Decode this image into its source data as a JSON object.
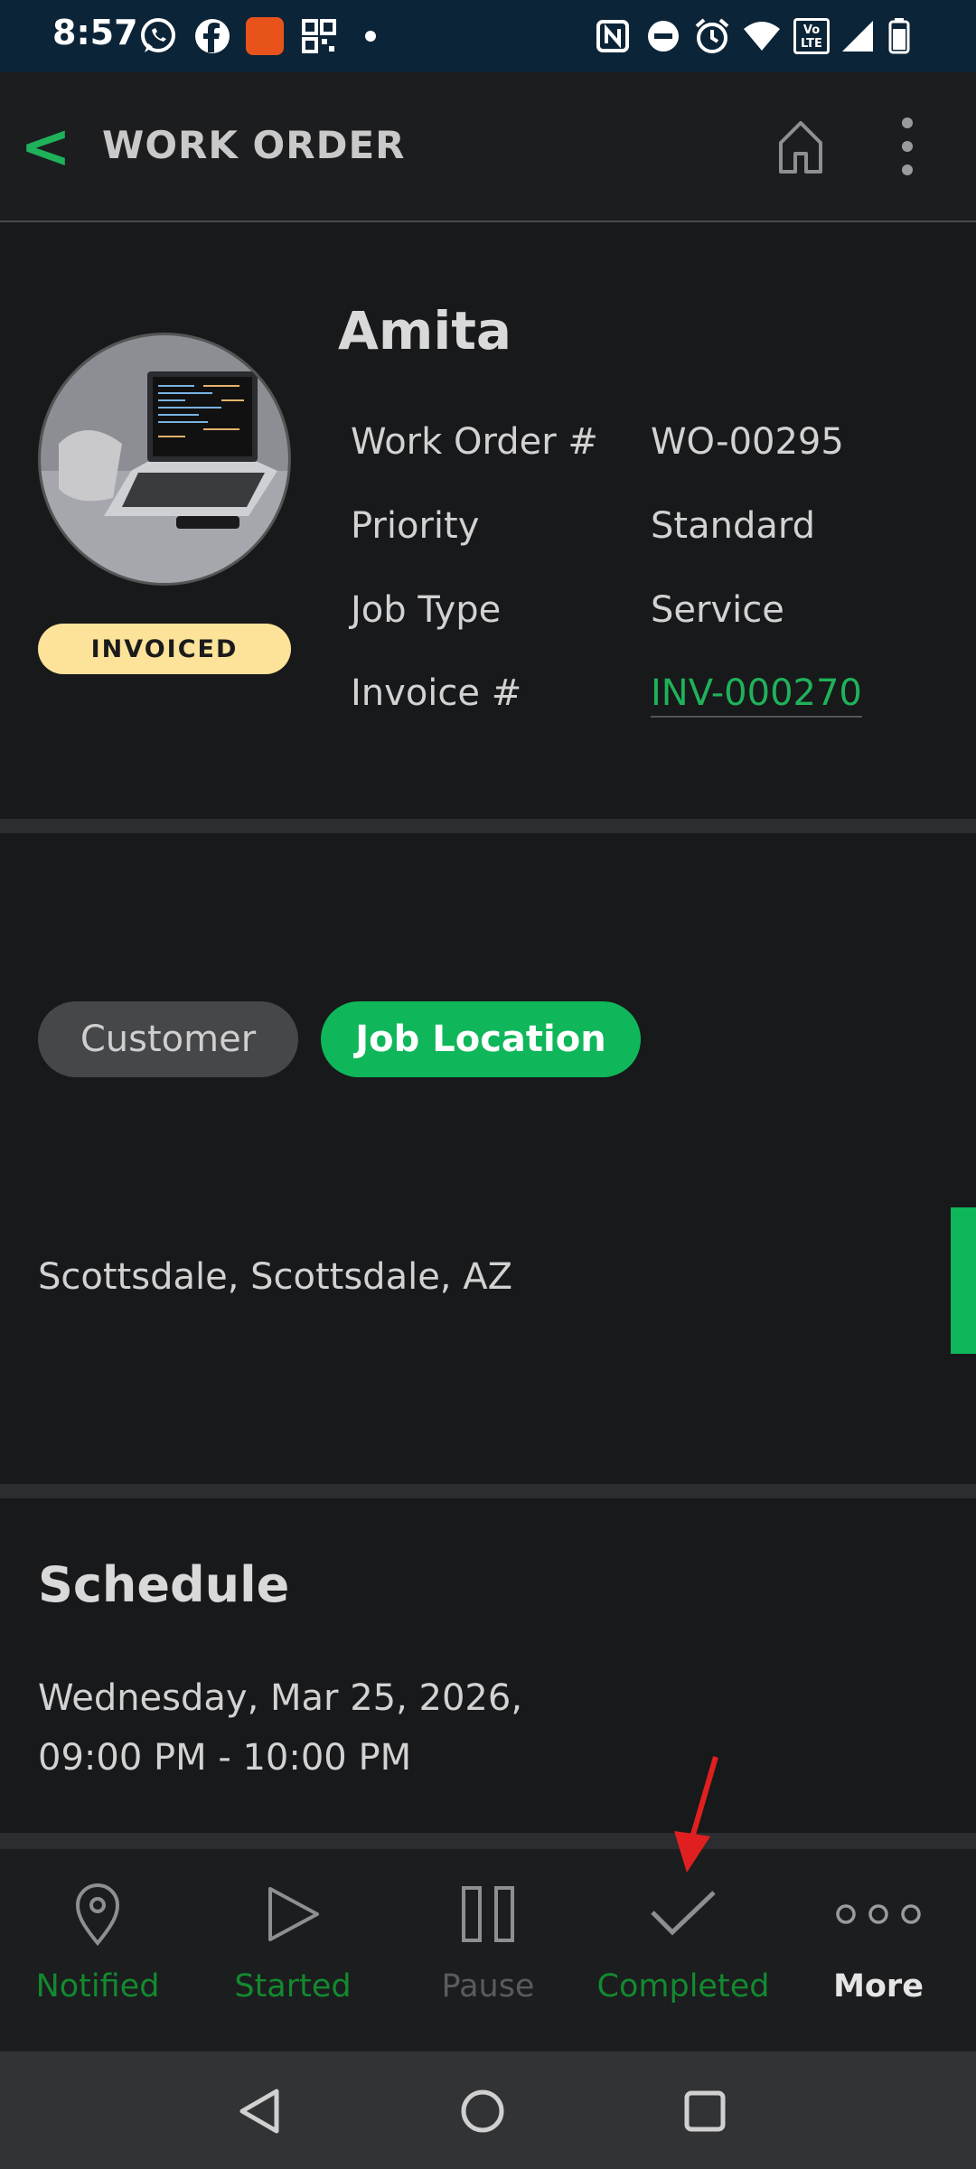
{
  "status_bar": {
    "time": "8:57",
    "icons": [
      "whatsapp-icon",
      "facebook-icon",
      "app-icon",
      "qr-icon",
      "dot-icon",
      "nfc-icon",
      "dnd-icon",
      "alarm-icon",
      "wifi-icon",
      "volte-icon",
      "signal-icon",
      "battery-icon"
    ],
    "volte_text": "Vo LTE"
  },
  "header": {
    "back_glyph": "<",
    "title": "WORK ORDER"
  },
  "summary": {
    "customer_name": "Amita",
    "status_badge": "INVOICED",
    "fields": [
      {
        "label": "Work Order #",
        "value": "WO-00295"
      },
      {
        "label": "Priority",
        "value": "Standard"
      },
      {
        "label": "Job Type",
        "value": "Service"
      },
      {
        "label": "Invoice #",
        "value": "INV-000270"
      }
    ]
  },
  "location": {
    "tabs": [
      {
        "label": "Customer",
        "active": false
      },
      {
        "label": "Job Location",
        "active": true
      }
    ],
    "address": "Scottsdale, Scottsdale, AZ"
  },
  "schedule": {
    "title": "Schedule",
    "date": "Wednesday, Mar 25, 2026,",
    "time": "09:00 PM - 10:00 PM"
  },
  "actions": [
    {
      "label": "Notified",
      "icon": "location-pin-icon",
      "state": "done"
    },
    {
      "label": "Started",
      "icon": "play-icon",
      "state": "done"
    },
    {
      "label": "Pause",
      "icon": "pause-icon",
      "state": "disabled"
    },
    {
      "label": "Completed",
      "icon": "check-icon",
      "state": "done"
    },
    {
      "label": "More",
      "icon": "more-icon",
      "state": "normal"
    }
  ],
  "colors": {
    "accent_green": "#0fb75a",
    "action_green": "#128a2f",
    "badge_yellow": "#fde39a",
    "annotation_red": "#e02020"
  }
}
